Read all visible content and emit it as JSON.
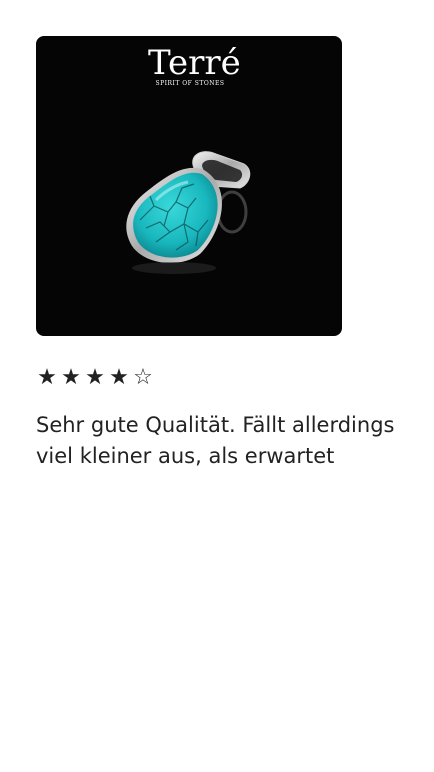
{
  "product": {
    "brand_logo": "Terré",
    "brand_tagline": "SPIRIT OF STONES",
    "image_alt": "turquoise-pendant-image"
  },
  "review": {
    "rating": 4,
    "rating_max": 5,
    "text": "Sehr gute Qualität. Fällt allerdings viel kleiner aus, als erwartet"
  },
  "icons": {
    "star_filled": "★",
    "star_empty": "☆"
  },
  "colors": {
    "image_background": "#050505",
    "stone_turquoise": "#22c4c8",
    "text": "#222222"
  }
}
